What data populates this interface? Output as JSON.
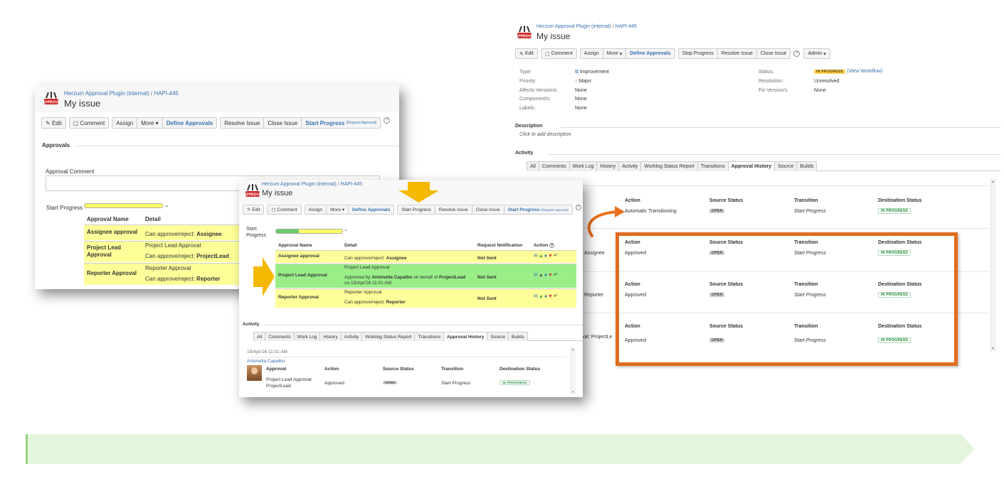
{
  "left": {
    "breadcrumb_project": "Herzum Approval Plugin (internal)",
    "breadcrumb_sep": "/",
    "breadcrumb_issue": "HAPI-445",
    "title": "My issue",
    "buttons": {
      "edit": "Edit",
      "comment": "Comment",
      "assign": "Assign",
      "more": "More",
      "define": "Define Approvals",
      "resolve": "Resolve Issue",
      "close": "Close Issue",
      "start": "Start Progress",
      "start_small": "(Request Approval)"
    },
    "section": "Approvals",
    "comment_label": "Approval Comment",
    "start_label": "Start Progress",
    "headers": {
      "name": "Approval Name",
      "detail": "Detail"
    },
    "rows": [
      {
        "name": "Assignee approval",
        "line1": "Can approve/reject:",
        "bold1": "Assignee",
        "line2": "",
        "bold2": ""
      },
      {
        "name": "Project Lead Approval",
        "line1": "Project Lead Approval",
        "bold1": "",
        "line2": "Can approve/reject:",
        "bold2": "ProjectLead"
      },
      {
        "name": "Reporter Approval",
        "line1": "Reporter Approval",
        "bold1": "",
        "line2": "Can approve/reject:",
        "bold2": "Reporter"
      }
    ]
  },
  "middle": {
    "breadcrumb_project": "Herzum Approval Plugin (internal)",
    "breadcrumb_sep": "/",
    "breadcrumb_issue": "HAPI-445",
    "title": "My issue",
    "buttons": {
      "edit": "Edit",
      "comment": "Comment",
      "assign": "Assign",
      "more": "More",
      "define": "Define Approvals",
      "start_top": "Start Progress",
      "resolve": "Resolve Issue",
      "close": "Close Issue",
      "start": "Start Progress",
      "start_small": "(Request Approval)"
    },
    "start_label": "Start Progress",
    "headers": {
      "name": "Approval Name",
      "detail": "Detail",
      "notif": "Request Notification",
      "action": "Action"
    },
    "rows": [
      {
        "name": "Assignee approval",
        "line1": "Can approve/reject:",
        "bold1": "Assignee",
        "notif": "Not Sent"
      },
      {
        "name": "Project Lead Approval",
        "line1": "Project Lead Approval",
        "line2a": "Approved by",
        "line2b": "Antonella Capalbo",
        "line2c": "on behalf of",
        "line2d": "ProjectLead",
        "line3": "on 19/Apr/16 11:01 AM",
        "notif": "Not Sent"
      },
      {
        "name": "Reporter Approval",
        "line1": "Reporter Approval",
        "line2": "Can approve/reject:",
        "bold2": "Reporter",
        "notif": "Not Sent"
      }
    ],
    "activity": "Activity",
    "tabs": [
      "All",
      "Comments",
      "Work Log",
      "History",
      "Activity",
      "Worklog Status Report",
      "Transitions",
      "Approval History",
      "Source",
      "Builds"
    ],
    "history": {
      "date": "19/Apr/16 11:01 AM",
      "user": "Antonella Capalbo",
      "headers": [
        "Approval",
        "Action",
        "Source Status",
        "Transition",
        "Destination Status"
      ],
      "approval1": "Project Lead Approval",
      "approval2": "ProjectLead",
      "action": "Approved",
      "source": "OPEN",
      "transition": "Start Progress",
      "dest": "IN PROGRESS"
    }
  },
  "right": {
    "breadcrumb_project": "Herzum Approval Plugin (internal)",
    "breadcrumb_sep": "/",
    "breadcrumb_issue": "HAPI-445",
    "title": "My issue",
    "buttons": {
      "edit": "Edit",
      "comment": "Comment",
      "assign": "Assign",
      "more": "More",
      "define": "Define Approvals",
      "stop": "Stop Progress",
      "resolve": "Resolve Issue",
      "close": "Close Issue",
      "admin": "Admin"
    },
    "details": {
      "type_l": "Type:",
      "type_v": "Improvement",
      "priority_l": "Priority:",
      "priority_v": "Major",
      "affects_l": "Affects Version/s:",
      "affects_v": "None",
      "component_l": "Component/s:",
      "component_v": "None",
      "labels_l": "Labels:",
      "labels_v": "None",
      "status_l": "Status:",
      "status_v": "IN PROGRESS",
      "workflow": "(View Workflow)",
      "resolution_l": "Resolution:",
      "resolution_v": "Unresolved",
      "fix_l": "Fix Version/s:",
      "fix_v": "None"
    },
    "description": "Description",
    "desc_placeholder": "Click to add description",
    "activity": "Activity",
    "tabs": [
      "All",
      "Comments",
      "Work Log",
      "History",
      "Activity",
      "Worklog Status Report",
      "Transitions",
      "Approval History",
      "Source",
      "Builds"
    ],
    "headers": [
      "Action",
      "Source Status",
      "Transition",
      "Destination Status"
    ],
    "rows": [
      {
        "left": "",
        "action": "Automatic Transitioning",
        "source": "OPEN",
        "transition": "Start Progress",
        "dest": "IN PROGRESS"
      },
      {
        "left": "Assignee",
        "action": "Approved",
        "source": "OPEN",
        "transition": "Start Progress",
        "dest": "IN PROGRESS"
      },
      {
        "left": "Reporter",
        "action": "Approved",
        "source": "OPEN",
        "transition": "Start Progress",
        "dest": "IN PROGRESS"
      },
      {
        "left": "val: ProjectLe",
        "action": "Approved",
        "source": "OPEN",
        "transition": "Start Progress",
        "dest": "IN PROGRESS"
      }
    ]
  },
  "colors": {
    "highlight": "#e06c1e",
    "arrow": "#f5b800",
    "green_band": "#e4f5dc",
    "link": "#3572b0"
  }
}
